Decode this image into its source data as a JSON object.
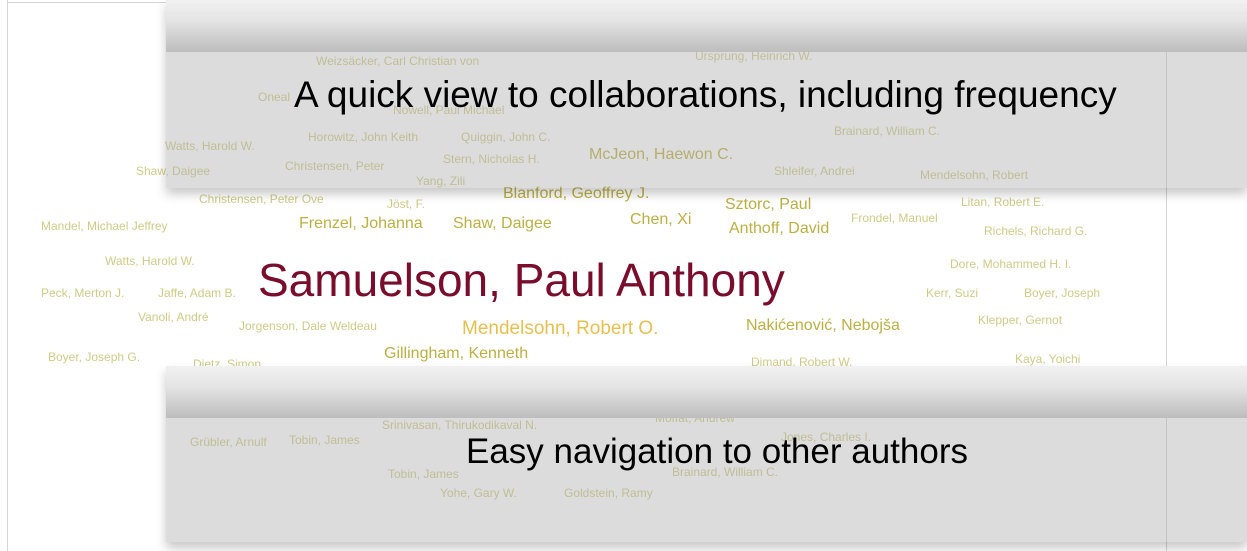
{
  "center_author": "Samuelson, Paul Anthony",
  "callouts": {
    "top": "A quick view to collaborations, including frequency",
    "bottom": "Easy navigation to other authors"
  },
  "coauthors": [
    "Weizsäcker, Carl Christian von",
    "Ursprung, Heinrich W.",
    "Oneal",
    "Nowell, Paul Michael",
    "Watts, Harold W.",
    "Horowitz, John Keith",
    "Quiggin, John C.",
    "Brainard, William C.",
    "Shaw, Daigee",
    "Christensen, Peter",
    "Stern, Nicholas H.",
    "McJeon, Haewon C.",
    "Shleifer, Andrei",
    "Mendelsohn, Robert",
    "Yang, Zili",
    "Christensen, Peter Ove",
    "Jöst, F.",
    "Blanford, Geoffrey J.",
    "Sztorc, Paul",
    "Litan, Robert E.",
    "Mandel, Michael Jeffrey",
    "Frenzel, Johanna",
    "Shaw, Daigee",
    "Chen, Xi",
    "Anthoff, David",
    "Frondel, Manuel",
    "Richels, Richard G.",
    "Watts, Harold W.",
    "Dore, Mohammed H. I.",
    "Peck, Merton J.",
    "Jaffe, Adam B.",
    "Kerr, Suzi",
    "Boyer, Joseph",
    "Vanoli, André",
    "Jorgenson, Dale Weldeau",
    "Mendelsohn, Robert O.",
    "Nakićenović, Nebojša",
    "Klepper, Gernot",
    "Boyer, Joseph G.",
    "Dietz, Simon",
    "Gillingham, Kenneth",
    "Dimand, Robert W.",
    "Kaya, Yoichi",
    "Srinivasan, Thirukodikaval N.",
    "Moffat, Andrew",
    "Grübler, Arnulf",
    "Tobin, James",
    "Jones, Charles I.",
    "Tobin, James",
    "Brainard, William C.",
    "Yohe, Gary W.",
    "Goldstein, Ramy"
  ]
}
